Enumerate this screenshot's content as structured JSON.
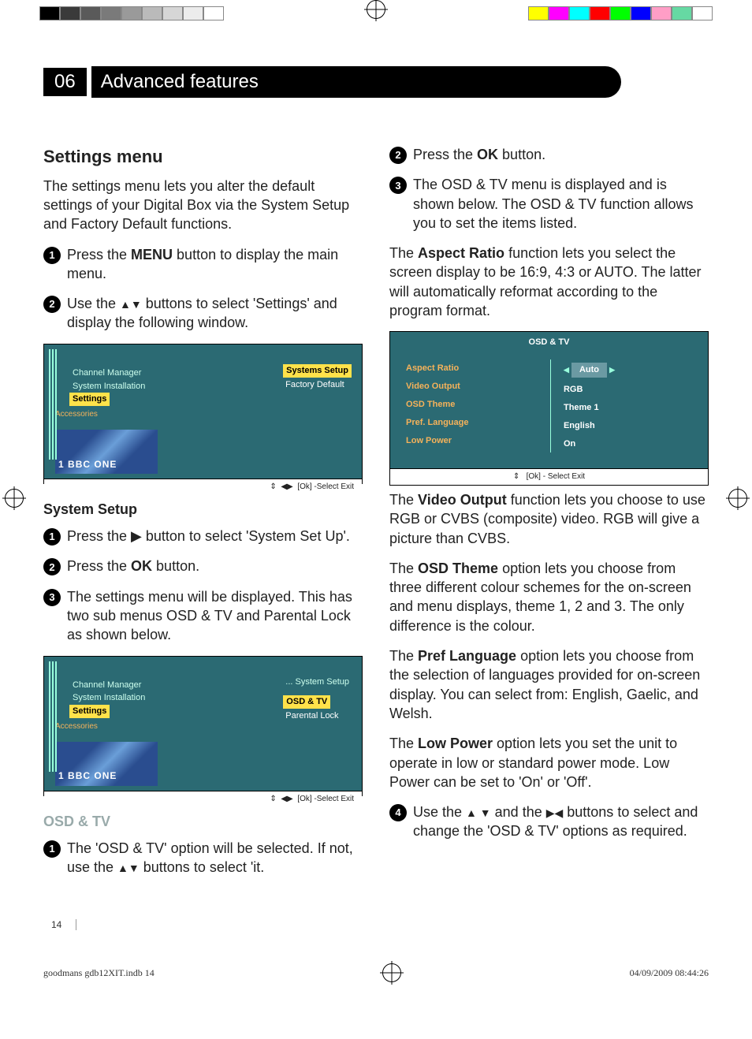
{
  "header": {
    "chapter_num": "06",
    "chapter_title": "Advanced features"
  },
  "left": {
    "h_settings_menu": "Settings menu",
    "intro": "The settings menu lets you alter the default settings of your Digital Box via the System Setup and Factory Default functions.",
    "step1_pre": "Press the ",
    "step1_bold": "MENU",
    "step1_post": " button to display the main menu.",
    "step2_pre": "Use the ",
    "step2_post": " buttons to select 'Settings' and display the following window.",
    "shot1": {
      "m_channel": "Channel Manager",
      "m_sysinstall": "System Installation",
      "m_settings": "Settings",
      "m_accessories": "Accessories",
      "sub_sys": "Systems Setup",
      "sub_factory": "Factory Default",
      "preview_ch": "1",
      "preview_name": "BBC ONE",
      "footer": "[Ok] -Select   Exit"
    },
    "h_system_setup": "System Setup",
    "ss_step1_pre": "Press the ",
    "ss_step1_post": " button to select 'System Set Up'.",
    "ss_step2_pre": "Press the ",
    "ss_step2_bold": "OK",
    "ss_step2_post": " button.",
    "ss_step3": "The settings menu will be displayed. This has two sub menus OSD & TV  and Parental Lock as shown below.",
    "shot2": {
      "crumb": "... System Setup",
      "sub_osdtv": "OSD & TV",
      "sub_parental": "Parental Lock",
      "footer": "[Ok] -Select   Exit"
    },
    "h_osdtv": "OSD & TV",
    "osd_step1_pre": "The 'OSD & TV' option will be selected. If not, use the ",
    "osd_step1_post": " buttons to select 'it."
  },
  "right": {
    "r_step2_pre": "Press the ",
    "r_step2_bold": "OK",
    "r_step2_post": " button.",
    "r_step3": "The OSD & TV menu is displayed and is shown below. The OSD & TV function allows you to set the items listed.",
    "aspect_para_pre": "The ",
    "aspect_para_bold": "Aspect Ratio",
    "aspect_para_post": " function lets you select the screen display to be 16:9, 4:3 or AUTO. The latter will automatically reformat according to the program format.",
    "shot3": {
      "title": "OSD & TV",
      "labels": {
        "aspect": "Aspect Ratio",
        "video": "Video Output",
        "theme": "OSD Theme",
        "lang": "Pref. Language",
        "low": "Low Power"
      },
      "vals": {
        "aspect": "Auto",
        "video": "RGB",
        "theme": "Theme 1",
        "lang": "English",
        "low": "On"
      },
      "footer": "[Ok] - Select      Exit"
    },
    "video_pre": "The ",
    "video_bold": "Video Output",
    "video_post": " function lets you choose to use RGB or CVBS (composite) video. RGB will give a picture than CVBS.",
    "theme_pre": "The ",
    "theme_bold": "OSD Theme",
    "theme_post": " option lets you choose from three different colour schemes for the on-screen and menu displays, theme 1, 2 and 3. The only difference is the colour.",
    "lang_pre": "The ",
    "lang_bold": "Pref Language",
    "lang_post": " option lets you choose from the selection of languages provided for on-screen display. You can select from: English, Gaelic, and Welsh.",
    "low_pre": "The ",
    "low_bold": "Low Power",
    "low_post": " option lets you set the unit to operate in low or standard power mode. Low Power can be set to 'On' or 'Off'.",
    "r_step4_a": "Use the ",
    "r_step4_b": " and the ",
    "r_step4_c": " buttons to select and change the 'OSD & TV' options as required."
  },
  "page_number": "14",
  "footer": {
    "file": "goodmans gdb12XIT.indb   14",
    "date": "04/09/2009   08:44:26"
  },
  "colorbar_left": [
    "#000",
    "#3a3a3a",
    "#5a5a5a",
    "#7a7a7a",
    "#9a9a9a",
    "#bababa",
    "#d6d6d6",
    "#ececec",
    "#fff"
  ],
  "colorbar_right": [
    "#ffff00",
    "#ff00ff",
    "#00ffff",
    "#ff0000",
    "#00ff00",
    "#0000ff",
    "#ff9ec6",
    "#66d9a3",
    "#fff"
  ]
}
